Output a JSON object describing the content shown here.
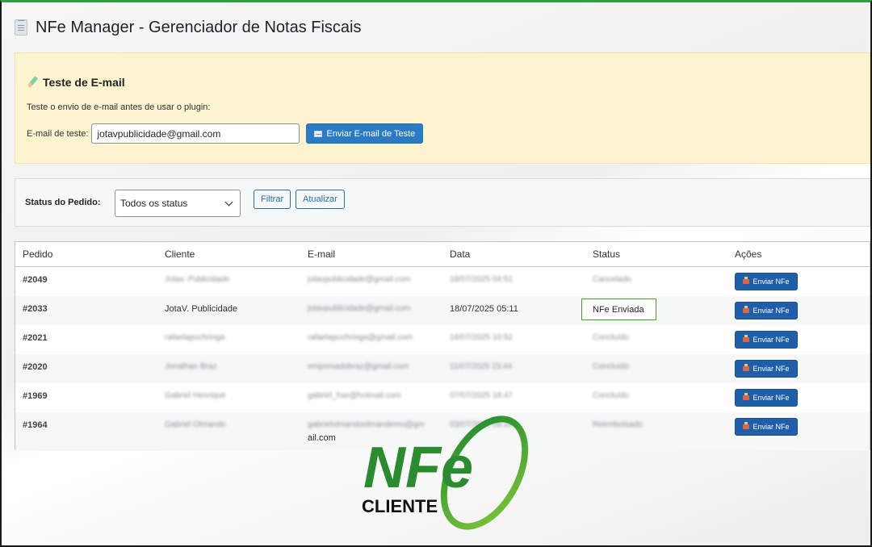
{
  "page": {
    "title": "NFe Manager - Gerenciador de Notas Fiscais"
  },
  "email_test": {
    "heading": "Teste de E-mail",
    "description": "Teste o envio de e-mail antes de usar o plugin:",
    "label": "E-mail de teste:",
    "value": "jotavpublicidade@gmail.com",
    "button": "Enviar E-mail de Teste"
  },
  "filter": {
    "label": "Status do Pedido:",
    "selected": "Todos os status",
    "filter_button": "Filtrar",
    "update_button": "Atualizar"
  },
  "table": {
    "headers": [
      "Pedido",
      "Cliente",
      "E-mail",
      "Data",
      "Status",
      "Ações"
    ],
    "action_label": "Enviar NFe",
    "rows": [
      {
        "id": "#2049",
        "client": "Jotav. Publicidade",
        "email": "jotavpublicidade@gmail.com",
        "date": "18/07/2025 04:51",
        "status": "Cancelado"
      },
      {
        "id": "#2033",
        "client": "JotaV. Publicidade",
        "email": "jotavpublicidade@gmail.com",
        "date": "18/07/2025 05:11",
        "status": "NFe Enviada"
      },
      {
        "id": "#2021",
        "client": "rafaelapuchringa",
        "email": "rafaelapuchringa@gmail.com",
        "date": "16/07/2025 10:52",
        "status": "Concluído"
      },
      {
        "id": "#2020",
        "client": "Jonathan Braz",
        "email": "empresadobraz@gmail.com",
        "date": "11/07/2025 23:44",
        "status": "Concluído"
      },
      {
        "id": "#1969",
        "client": "Gabriel Henrique",
        "email": "gabriel_hse@hotmail.com",
        "date": "07/07/2025 18:47",
        "status": "Concluído"
      },
      {
        "id": "#1964",
        "client": "Gabriel Olmando",
        "email": "gabrielolmandoolmandemo@gm",
        "email_tail": "ail.com",
        "date": "03/07/2025 09:20",
        "status": "Reembolsado"
      }
    ]
  },
  "logo": {
    "brand": "NFe",
    "subtitle": "CLIENTE"
  },
  "colors": {
    "accent": "#2271b1",
    "brand_green": "#2f9e44",
    "panel_yellow": "#fcf3cf"
  }
}
